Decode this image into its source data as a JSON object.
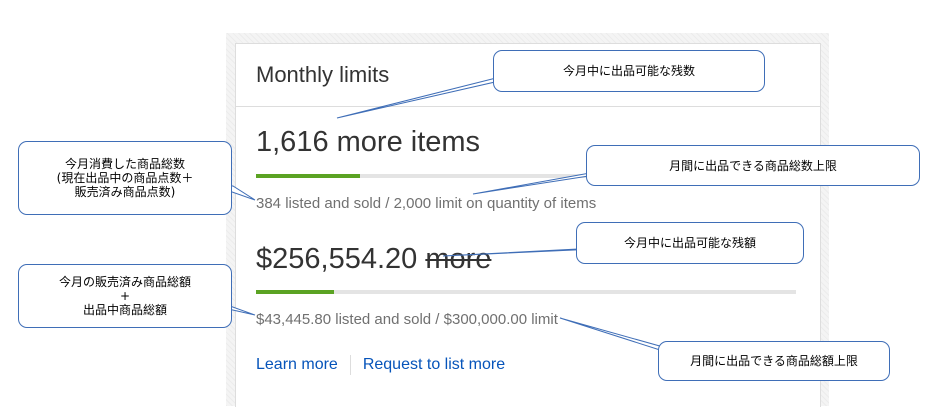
{
  "card": {
    "title": "Monthly limits",
    "items": {
      "value_text": "1,616 more items",
      "progress_fraction": 0.192,
      "summary": "384 listed and sold /  2,000 limit on quantity of items"
    },
    "amount": {
      "value_text": "$256,554.20",
      "more_text": "more",
      "progress_fraction": 0.145,
      "summary": "$43,445.80 listed and sold /  $300,000.00 limit"
    },
    "links": {
      "learn_more": "Learn more",
      "request": "Request to list more"
    }
  },
  "callouts": {
    "remaining_items": "今月中に出品可能な残数",
    "items_limit": "月間に出品できる商品総数上限",
    "items_used": "今月消費した商品総数\n(現在出品中の商品点数＋\n販売済み商品点数)",
    "remaining_amount": "今月中に出品可能な残額",
    "amount_used": "今月の販売済み商品総額\n+\n出品中商品総額",
    "amount_limit": "月間に出品できる商品総額上限"
  },
  "colors": {
    "progress_fill": "#5ba323",
    "progress_track": "#e4e4e4",
    "link": "#0654ba",
    "callout_border": "#3f6eb7"
  }
}
